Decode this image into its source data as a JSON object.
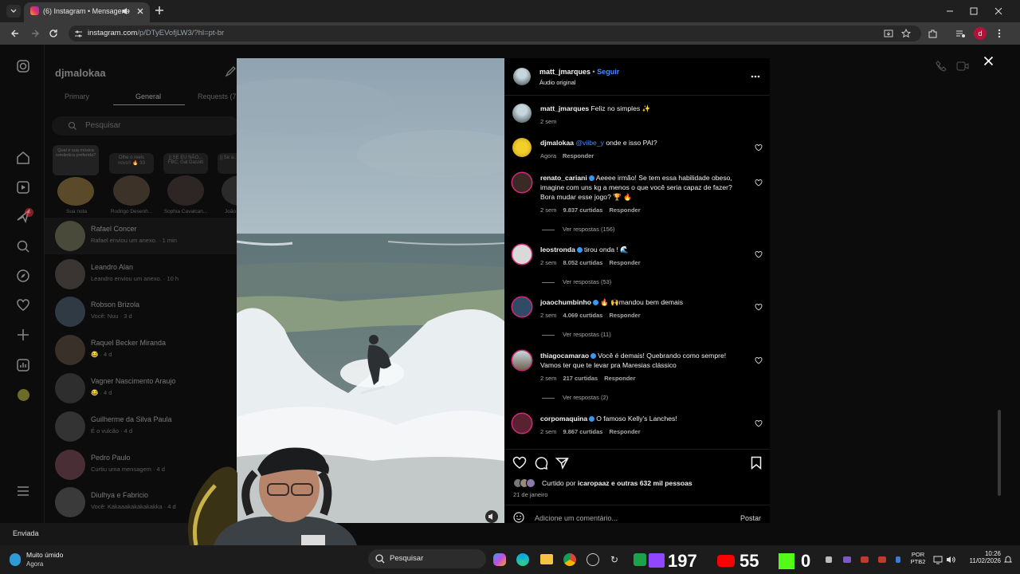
{
  "browser": {
    "tab_title": "(6) Instagram • Mensagens",
    "url_host": "instagram.com",
    "url_path": "/p/DTyEVofjLW3/?hl=pt-br"
  },
  "dm": {
    "username": "djmalokaa",
    "tabs": [
      "Primary",
      "General",
      "Requests (7"
    ],
    "search_placeholder": "Pesquisar",
    "notes": [
      {
        "label": "Qual é sua música romântica preferida?",
        "name": "Sua nota"
      },
      {
        "label": "Olhe o reels novo!! 🔥 33",
        "name": "Rodrigo Desenh..."
      },
      {
        "label": "|| SE EU NÃO... FBC, Gal Dassiti",
        "name": "Sophia Cavalcan..."
      },
      {
        "label": "|| Se a... Ham",
        "name": "João"
      }
    ],
    "conversations": [
      {
        "name": "Rafael Concer",
        "sub": "Rafael enviou um anexo. · 1 min"
      },
      {
        "name": "Leandro Alan",
        "sub": "Leandro enviou um anexo. · 10 h"
      },
      {
        "name": "Robson Brizola",
        "sub": "Você: Nuu · 3 d"
      },
      {
        "name": "Raquel Becker Miranda",
        "sub": "😂 · 4 d"
      },
      {
        "name": "Vagner Nascimento Araujo",
        "sub": "😂 · 4 d"
      },
      {
        "name": "Guilherme da Silva Paula",
        "sub": "É o vulcão · 4 d"
      },
      {
        "name": "Pedro Paulo",
        "sub": "Curtiu uma mensagem · 4 d"
      },
      {
        "name": "Diulhya e Fabricio",
        "sub": "Você: Kakaaakakakakakka · 4 d"
      }
    ],
    "sent_label": "Enviada",
    "badge_count": "4"
  },
  "post": {
    "author": "matt_jmarques",
    "follow_label": "Seguir",
    "audio": "Áudio original",
    "caption": "Feliz no simples ✨",
    "caption_time": "2 sem",
    "comments": [
      {
        "user": "djmalokaa",
        "mention": "@viibe_y",
        "text": "onde e isso PAI?",
        "time": "Agora",
        "likes": "",
        "reply": "Responder",
        "replies": ""
      },
      {
        "user": "renato_cariani",
        "verified": true,
        "text": "Aeeee irmão! Se tem essa habilidade obeso, imagine com uns kg a menos o que você seria capaz de fazer? Bora mudar esse jogo? 🏆 🔥",
        "time": "2 sem",
        "likes": "9.837 curtidas",
        "reply": "Responder",
        "replies": "Ver respostas (156)"
      },
      {
        "user": "leostronda",
        "verified": true,
        "text": "tirou onda ! 🌊",
        "time": "2 sem",
        "likes": "8.052 curtidas",
        "reply": "Responder",
        "replies": "Ver respostas (53)"
      },
      {
        "user": "joaochumbinho",
        "verified": true,
        "text": "🔥 🙌mandou bem demais",
        "time": "2 sem",
        "likes": "4.069 curtidas",
        "reply": "Responder",
        "replies": "Ver respostas (11)"
      },
      {
        "user": "thiagocamarao",
        "verified": true,
        "text": "Você é demais! Quebrando como sempre! Vamos ter que te levar pra Maresias clássico",
        "time": "2 sem",
        "likes": "217 curtidas",
        "reply": "Responder",
        "replies": "Ver respostas (2)"
      },
      {
        "user": "corpomaquina",
        "verified": true,
        "text": "O famoso Kelly's Lanches!",
        "time": "2 sem",
        "likes": "9.867 curtidas",
        "reply": "Responder",
        "replies": ""
      }
    ],
    "liked_by_prefix": "Curtido por",
    "liked_by_user": "icaropaaz",
    "liked_by_suffix": "e outras 632 mil pessoas",
    "date": "21 de janeiro",
    "comment_placeholder": "Adicione um comentário...",
    "post_button": "Postar"
  },
  "taskbar": {
    "weather_title": "Muito úmido",
    "weather_sub": "Agora",
    "search_label": "Pesquisar",
    "stat_1": "197",
    "stat_2": "55",
    "stat_3": "0",
    "lang": "POR",
    "lang_sub": "PTB2",
    "time": "10:26",
    "date": "11/02/2026"
  },
  "colors": {
    "link_blue": "#4d8df6",
    "verified_blue": "#3897f0",
    "notif_red": "#ff3040"
  }
}
